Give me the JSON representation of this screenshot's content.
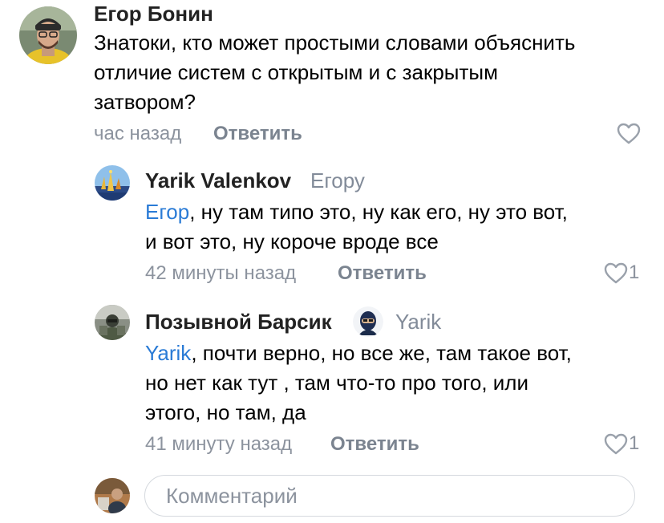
{
  "comments": [
    {
      "author": "Егор Бонин",
      "text_lines": [
        "Знатоки, кто может простыми словами объяснить",
        "отличие систем с открытым и с закрытым",
        "затвором?"
      ],
      "time": "час назад",
      "reply_label": "Ответить",
      "likes": ""
    }
  ],
  "replies": [
    {
      "author": "Yarik Valenkov",
      "reply_to": "Егору",
      "mention": "Егор",
      "line1_rest": ", ну там типо это, ну как его, ну это вот,",
      "text_lines_rest": [
        "и вот это, ну короче вроде все"
      ],
      "time": "42 минуты назад",
      "reply_label": "Ответить",
      "likes": "1"
    },
    {
      "author": "Позывной Барсик",
      "reply_to": "Yarik",
      "mention": "Yarik",
      "line1_rest": ", почти верно, но все же, там такое вот,",
      "text_lines_rest": [
        "но нет как тут , там что-то про того, или",
        "этого, но там, да"
      ],
      "time": "41 минуту назад",
      "reply_label": "Ответить",
      "likes": "1"
    }
  ],
  "composer": {
    "placeholder": "Комментарий"
  },
  "colors": {
    "mention": "#2a7bd6",
    "meta": "#8c939e",
    "reply_button": "#7b8490"
  },
  "icons": [
    "heart-icon",
    "avatar",
    "verified-badge-icon"
  ]
}
